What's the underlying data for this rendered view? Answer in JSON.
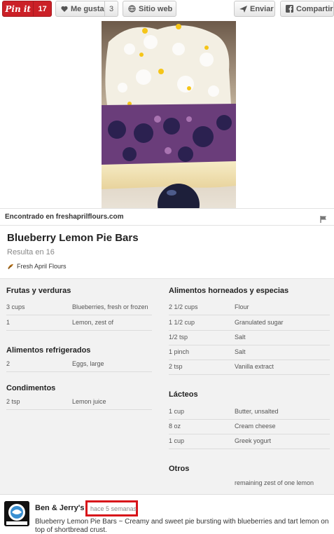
{
  "toolbar": {
    "pinit_label": "Pin it",
    "pinit_count": "17",
    "like_label": "Me gusta",
    "like_count": "3",
    "site_label": "Sitio web",
    "send_label": "Enviar",
    "share_label": "Compartir"
  },
  "found": {
    "text": "Encontrado en freshaprilflours.com"
  },
  "recipe": {
    "title": "Blueberry Lemon Pie Bars",
    "servings": "Resulta en 16",
    "source": "Fresh April Flours"
  },
  "ingredients": {
    "left": [
      {
        "category": "Frutas y verduras",
        "items": [
          {
            "qty": "3 cups",
            "name": "Blueberries, fresh or frozen"
          },
          {
            "qty": "1",
            "name": "Lemon, zest of"
          }
        ]
      },
      {
        "category": "Alimentos refrigerados",
        "items": [
          {
            "qty": "2",
            "name": "Eggs, large"
          }
        ]
      },
      {
        "category": "Condimentos",
        "items": [
          {
            "qty": "2 tsp",
            "name": "Lemon juice"
          }
        ]
      }
    ],
    "right": [
      {
        "category": "Alimentos horneados y especias",
        "items": [
          {
            "qty": "2 1/2 cups",
            "name": "Flour"
          },
          {
            "qty": "1 1/2 cup",
            "name": "Granulated sugar"
          },
          {
            "qty": "1/2 tsp",
            "name": "Salt"
          },
          {
            "qty": "1 pinch",
            "name": "Salt"
          },
          {
            "qty": "2 tsp",
            "name": "Vanilla extract"
          }
        ]
      },
      {
        "category": "Lácteos",
        "items": [
          {
            "qty": "1 cup",
            "name": "Butter, unsalted"
          },
          {
            "qty": "8 oz",
            "name": "Cream cheese"
          },
          {
            "qty": "1 cup",
            "name": "Greek yogurt"
          }
        ]
      },
      {
        "category": "Otros",
        "items": [
          {
            "qty": "",
            "name": "remaining zest of one lemon"
          }
        ]
      }
    ]
  },
  "pinner": {
    "name": "Ben & Jerry's",
    "time": "hace 5 semanas",
    "description": "Blueberry Lemon Pie Bars ~ Creamy and sweet pie bursting with blueberries and tart lemon on top of shortbread crust.",
    "avatar_text": "BEN & JERRY'S"
  },
  "colors": {
    "pinit_red": "#cb2027",
    "highlight_red": "#d8141a",
    "panel_bg": "#f2f2f2"
  },
  "icons": [
    "heart-icon",
    "globe-icon",
    "send-icon",
    "facebook-icon",
    "flag-icon",
    "source-icon"
  ]
}
